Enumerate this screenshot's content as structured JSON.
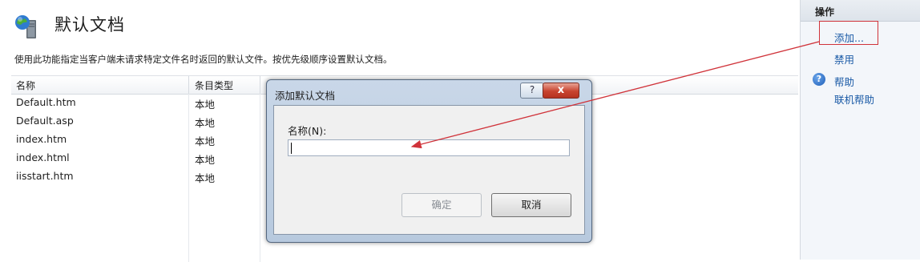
{
  "header": {
    "title": "默认文档",
    "description": "使用此功能指定当客户端未请求特定文件名时返回的默认文件。按优先级顺序设置默认文档。",
    "icon": "globe-server-icon"
  },
  "table": {
    "columns": [
      "名称",
      "条目类型"
    ],
    "rows": [
      {
        "name": "Default.htm",
        "type": "本地"
      },
      {
        "name": "Default.asp",
        "type": "本地"
      },
      {
        "name": "index.htm",
        "type": "本地"
      },
      {
        "name": "index.html",
        "type": "本地"
      },
      {
        "name": "iisstart.htm",
        "type": "本地"
      }
    ]
  },
  "actions": {
    "title": "操作",
    "add": "添加...",
    "disable": "禁用",
    "help": "帮助",
    "online_help": "联机帮助"
  },
  "dialog": {
    "title": "添加默认文档",
    "help_button": "?",
    "close_button": "x",
    "name_label": "名称(N):",
    "name_value": "",
    "ok": "确定",
    "cancel": "取消"
  },
  "colors": {
    "annotation": "#d0333a",
    "link": "#1a5aa6"
  }
}
